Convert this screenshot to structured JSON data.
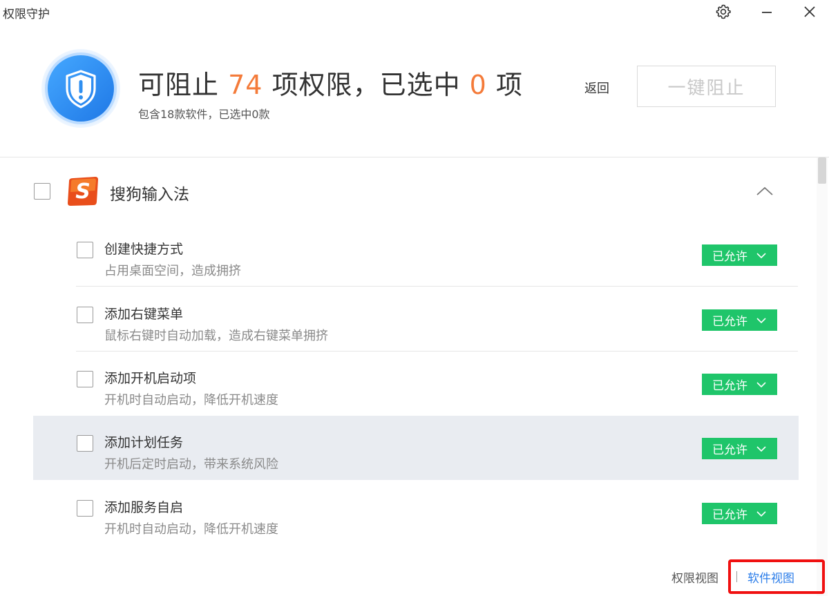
{
  "window": {
    "title": "权限守护"
  },
  "header": {
    "headline_prefix": "可阻止",
    "blockable_count": "74",
    "headline_middle": "项权限，已选中",
    "selected_count": "0",
    "headline_suffix": "项",
    "subtitle": "包含18款软件，已选中0款",
    "back_label": "返回",
    "block_button_label": "一键阻止"
  },
  "app_group": {
    "name": "搜狗输入法",
    "icon_letter": "S"
  },
  "permissions": [
    {
      "title": "创建快捷方式",
      "desc": "占用桌面空间，造成拥挤",
      "status": "已允许"
    },
    {
      "title": "添加右键菜单",
      "desc": "鼠标右键时自动加载，造成右键菜单拥挤",
      "status": "已允许"
    },
    {
      "title": "添加开机启动项",
      "desc": "开机时自动启动，降低开机速度",
      "status": "已允许"
    },
    {
      "title": "添加计划任务",
      "desc": "开机后定时启动，带来系统风险",
      "status": "已允许"
    },
    {
      "title": "添加服务自启",
      "desc": "开机时自动启动，降低开机速度",
      "status": "已允许"
    }
  ],
  "footer": {
    "permission_view": "权限视图",
    "software_view": "软件视图"
  },
  "colors": {
    "accent_orange": "#f47b3a",
    "status_green": "#1fc56a",
    "link_blue": "#2b7de9",
    "highlight_red": "#f01010",
    "shield_blue": "#2f8ff0"
  },
  "icons": {
    "settings": "gear-icon",
    "minimize": "minimize-icon",
    "close": "close-icon",
    "header": "shield-alert-icon",
    "collapse": "chevron-up-icon",
    "dropdown": "chevron-down-icon"
  }
}
